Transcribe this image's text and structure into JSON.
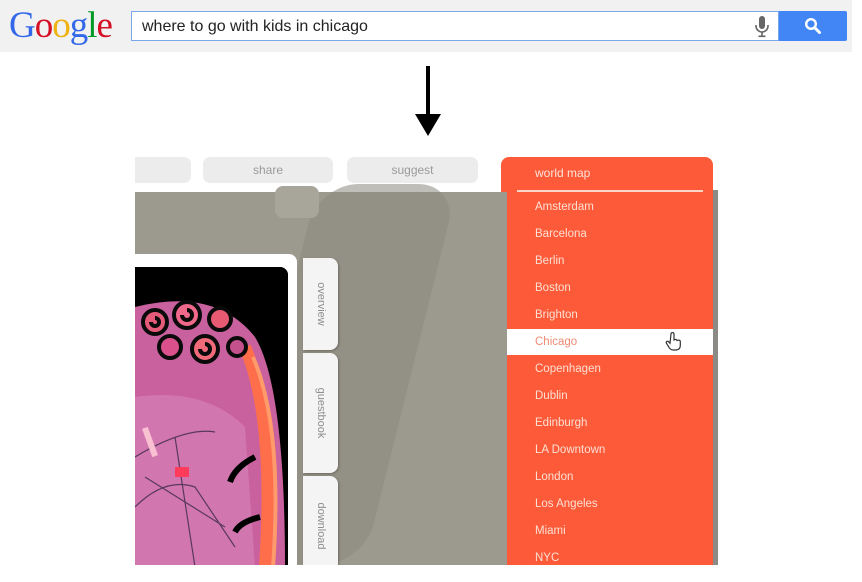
{
  "google": {
    "logo_letters": [
      "G",
      "o",
      "o",
      "g",
      "l",
      "e"
    ],
    "query": "where to go with kids in chicago",
    "mic_icon": "microphone-icon",
    "search_icon": "magnifier-icon",
    "colors": {
      "blue": "#4285f4",
      "bar_bg": "#f1f1f1"
    }
  },
  "arrow_icon": "down-arrow-icon",
  "site": {
    "nav": [
      {
        "label": ""
      },
      {
        "label": "share"
      },
      {
        "label": "suggest"
      }
    ],
    "dropdown": {
      "label": "world map",
      "accent": "#fc5a39",
      "items": [
        "Amsterdam",
        "Barcelona",
        "Berlin",
        "Boston",
        "Brighton",
        "Chicago",
        "Copenhagen",
        "Dublin",
        "Edinburgh",
        "LA Downtown",
        "London",
        "Los Angeles",
        "Miami",
        "NYC"
      ],
      "selected": "Chicago"
    },
    "side_tabs": [
      {
        "label": "overview"
      },
      {
        "label": "guestbook"
      },
      {
        "label": "download"
      }
    ]
  }
}
